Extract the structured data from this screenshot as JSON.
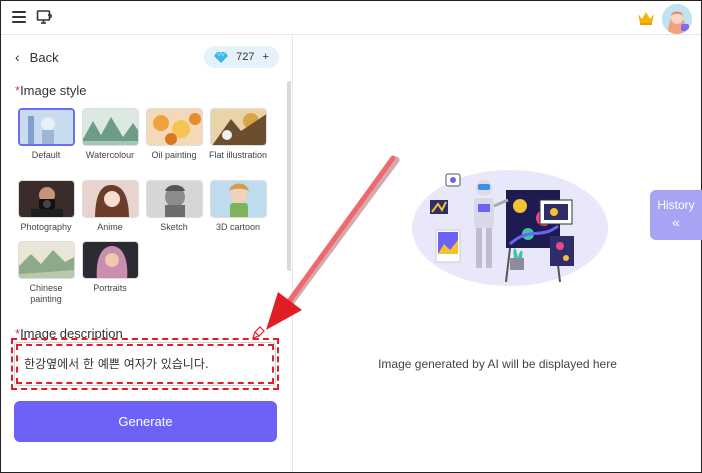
{
  "topbar": {
    "menu_icon": "hamburger-icon",
    "app_icon": "monitor-icon",
    "crown_icon": "crown-icon"
  },
  "panel": {
    "back_label": "Back",
    "credits": "727",
    "credits_plus": "+",
    "image_style_label": "Image style",
    "image_description_label": "Image description",
    "required_mark": "*"
  },
  "styles": [
    {
      "label": "Default",
      "selected": true
    },
    {
      "label": "Watercolour",
      "selected": false
    },
    {
      "label": "Oil painting",
      "selected": false
    },
    {
      "label": "Flat illustration",
      "selected": false
    },
    {
      "label": "Photography",
      "selected": false
    },
    {
      "label": "Anime",
      "selected": false
    },
    {
      "label": "Sketch",
      "selected": false
    },
    {
      "label": "3D cartoon",
      "selected": false
    },
    {
      "label": "Chinese painting",
      "selected": false
    },
    {
      "label": "Portraits",
      "selected": false
    }
  ],
  "description": {
    "value": "한강옆에서 한 예쁜 여자가 있습니다."
  },
  "generate_label": "Generate",
  "main": {
    "empty_text": "Image generated by AI will be displayed here",
    "history_label": "History",
    "history_arrows": "«"
  },
  "colors": {
    "accent": "#6c63f6",
    "history_tab": "#a8a4f5",
    "annotation_red": "#e11e26",
    "credits_bg": "#e5f2fc"
  }
}
